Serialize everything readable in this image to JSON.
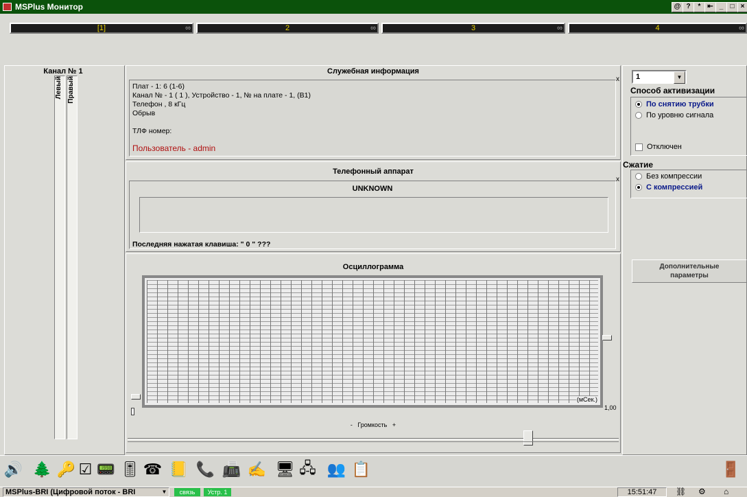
{
  "window": {
    "title": "MSPlus Монитор",
    "buttons": [
      "@",
      "?",
      "*",
      "⇤",
      "_",
      "□",
      "×"
    ]
  },
  "channel_tabs": [
    {
      "label": "[1]",
      "inf": "∞"
    },
    {
      "label": "2",
      "inf": "∞"
    },
    {
      "label": "3",
      "inf": "∞"
    },
    {
      "label": "4",
      "inf": "∞"
    }
  ],
  "left_panel": {
    "title": "Канал № 1",
    "left_label": "Левый",
    "right_label": "Правый"
  },
  "service": {
    "header": "Служебная информация",
    "close": "x",
    "lines": [
      "Плат - 1:  6 (1-6)",
      "Канал № - 1 ( 1 ), Устройство - 1, № на плате - 1, (В1)",
      "Телефон , 8 кГц",
      "Обрыв",
      "",
      "ТЛФ номер:"
    ],
    "user": "Пользователь - admin"
  },
  "phone": {
    "header": "Телефонный аппарат",
    "close": "x",
    "device": "UNKNOWN",
    "last_key": "Последняя нажатая клавиша:  \" 0 \" ???"
  },
  "osc": {
    "header": "Осциллограмма",
    "unit": "(мСек.)",
    "scale": "1,00",
    "volume": "-   Громкость   +"
  },
  "right": {
    "channel_value": "1",
    "activation": {
      "title": "Способ активизации",
      "options": [
        "По снятию трубки",
        "По уровню сигнала"
      ],
      "selected": 0
    },
    "disabled_label": "Отключен",
    "compression": {
      "title": "Сжатие",
      "options": [
        "Без компрессии",
        "С компрессией"
      ],
      "selected": 1
    },
    "extra_button": "Дополнительные параметры"
  },
  "toolbar_icons": [
    "speaker-icon",
    "tree-icon",
    "key-icon",
    "checklist-icon",
    "device-icon",
    "mixer-icon",
    "hand-phone-icon",
    "phone-book-icon",
    "phone-user-icon",
    "fax-icon",
    "write-icon",
    "board-icon",
    "network-icon",
    "users-icon",
    "copy-icon"
  ],
  "status": {
    "device": "MSPlus-BRI (Цифровой поток - BRI",
    "link": "связь",
    "dev": "Устр. 1",
    "time": "15:51:47"
  },
  "colors": {
    "title_bg": "#0b520b",
    "status_green": "#29c04a",
    "user_red": "#b01010",
    "selected_blue": "#0a1a8a"
  }
}
